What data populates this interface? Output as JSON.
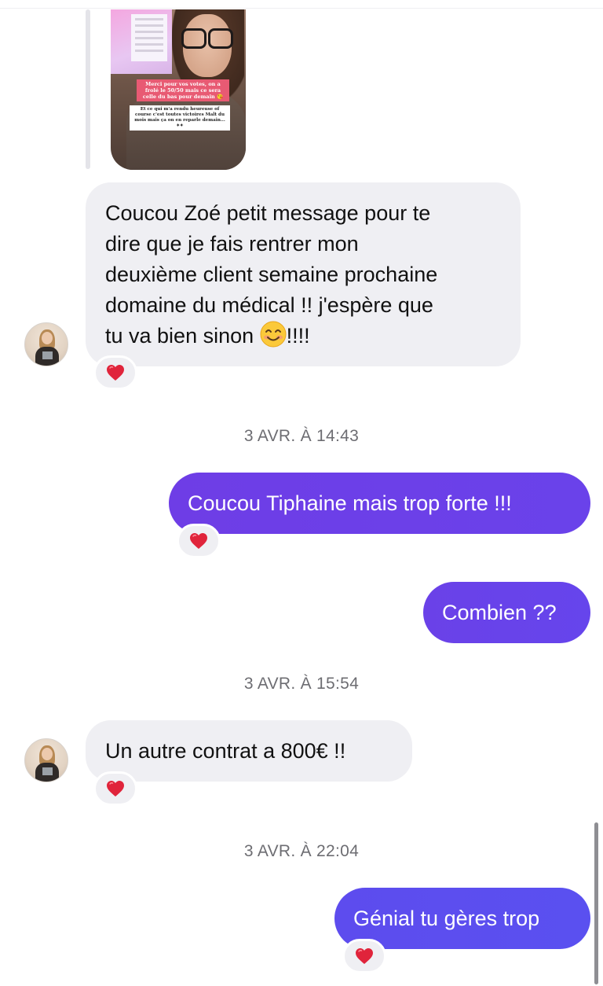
{
  "story_reply": {
    "caption_top": "Merci pour vos votes, on a frolé le 50/50 mais ce sera celle du bas pour demain 😘",
    "caption_bottom": "Et ce qui m'a rendu heureuse of course c'est toutes victoires Malt du mois mais ça on en reparle demain... ✦✦"
  },
  "messages": [
    {
      "direction": "incoming",
      "lines": [
        "Coucou Zoé petit message pour te",
        "dire que je fais rentrer mon",
        "deuxième client semaine prochaine",
        "domaine du médical !! j'espère que",
        "tu va bien sinon"
      ],
      "line_end_after_emoji": "!!!!",
      "emoji": "smiling-face",
      "reaction": "❤️"
    },
    {
      "type": "timestamp",
      "text": "3 AVR. À 14:43"
    },
    {
      "direction": "outgoing",
      "text": "Coucou Tiphaine mais trop forte !!!",
      "reaction": "❤️"
    },
    {
      "direction": "outgoing",
      "text": "Combien ??"
    },
    {
      "type": "timestamp",
      "text": "3 AVR. À 15:54"
    },
    {
      "direction": "incoming",
      "text": "Un autre contrat a 800€ !!",
      "reaction": "❤️"
    },
    {
      "type": "timestamp",
      "text": "3 AVR. À 22:04"
    },
    {
      "direction": "outgoing",
      "text": "Génial tu gères trop",
      "reaction": "❤️"
    }
  ],
  "colors": {
    "outgoing_bubble_start": "#6e3de6",
    "outgoing_bubble_end": "#5b4ff0",
    "incoming_bubble": "#efeff3",
    "heart": "#e0243b",
    "timestamp_text": "#6d6d72"
  }
}
